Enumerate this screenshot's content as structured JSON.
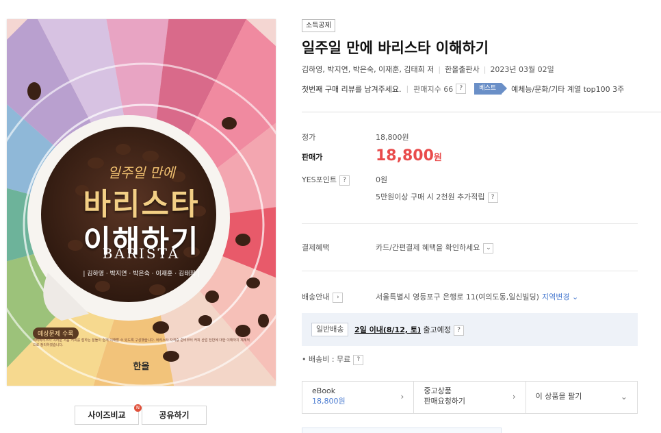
{
  "cover": {
    "kicker": "일주일 만에",
    "title_line1": "바리스타",
    "title_line2": "이해하기",
    "english": "BARISTA",
    "authors": "| 김하영 · 박지연 · 박은숙 · 이재훈 · 김태희 |",
    "badge": "예상문제 수록",
    "description": "예비바리스타 여러분 처음 커피를 접하는 분들이 쉽게 이해할 수 있도록 구성했습니다. 바리스타 자격증 준비부터 커피 산업 전반에 대한 이해까지 체계적으로 정리하였습니다.",
    "publisher": "한올"
  },
  "buttons": {
    "size_compare": "사이즈비교",
    "share": "공유하기",
    "new_badge": "N"
  },
  "product": {
    "tag": "소득공제",
    "title": "일주일 만에 바리스타 이해하기",
    "authors": "김하영, 박지연, 박은숙, 이재훈, 김태희 저",
    "publisher": "한올출판사",
    "date": "2023년 03월 02일",
    "review_prompt": "첫번째 구매 리뷰를 남겨주세요.",
    "sales_index": "판매지수 66",
    "best_label": "베스트",
    "best_rank": "예체능/문화/기타 계열 top100 3주"
  },
  "price": {
    "list_label": "정가",
    "list_value": "18,800원",
    "sale_label": "판매가",
    "sale_number": "18,800",
    "sale_unit": "원",
    "point_label": "YES포인트",
    "point_value": "0원",
    "point_note": "5만원이상 구매 시 2천원 추가적립"
  },
  "payment": {
    "label": "결제혜택",
    "value": "카드/간편결제 혜택을 확인하세요"
  },
  "shipping": {
    "label": "배송안내",
    "address": "서울특별시 영등포구 은행로 11(여의도동,일신빌딩)",
    "change_region": "지역변경",
    "type": "일반배송",
    "date_bold": "2일 이내(8/12, 토)",
    "date_suffix": "출고예정",
    "fee": "배송비 : 무료"
  },
  "options": {
    "ebook_label": "eBook",
    "ebook_price": "18,800원",
    "used_line1": "중고상품",
    "used_line2": "판매요청하기",
    "sell_label": "이 상품을 팔기"
  },
  "colors": {
    "sale_red": "#e94b4b",
    "link_blue": "#4a7bd0",
    "best_badge": "#6a8fc7",
    "ship_bg": "#eef2f8"
  }
}
